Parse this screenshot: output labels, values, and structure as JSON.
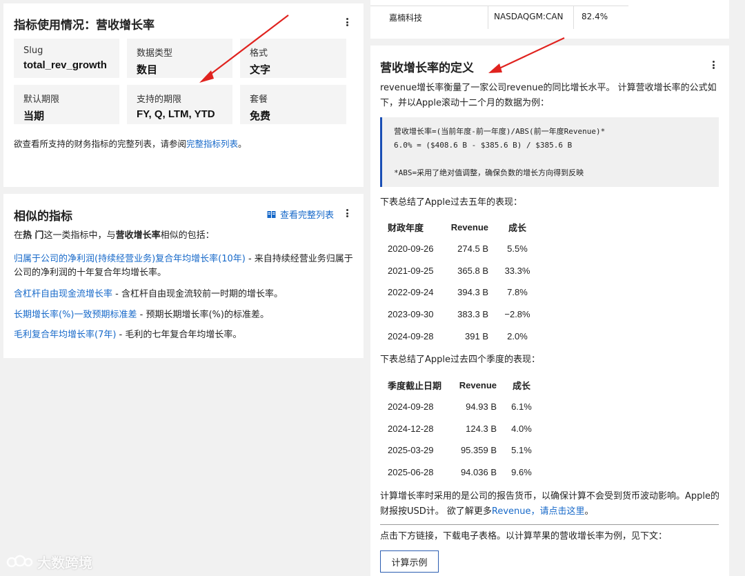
{
  "usage_card": {
    "title": "指标使用情况：营收增长率",
    "tiles": [
      {
        "label": "Slug",
        "value": "total_rev_growth"
      },
      {
        "label": "数据类型",
        "value": "数目"
      },
      {
        "label": "格式",
        "value": "文字"
      },
      {
        "label": "默认期限",
        "value": "当期"
      },
      {
        "label": "支持的期限",
        "value": "FY, Q, LTM, YTD"
      },
      {
        "label": "套餐",
        "value": "免费"
      }
    ],
    "note_prefix": "欲查看所支持的财务指标的完整列表，请参阅",
    "note_link": "完整指标列表",
    "note_suffix": "。"
  },
  "similar_card": {
    "title": "相似的指标",
    "view_all": "查看完整列表",
    "intro_1": "在",
    "intro_hot": "热 门",
    "intro_2": "这一类指标中，与",
    "intro_metric": "营收增长率",
    "intro_3": "相似的包括：",
    "items": [
      {
        "link": "归属于公司的净利润(持续经营业务)复合年均增长率(10年)",
        "desc": " - 来自持续经营业务归属于公司的净利润的十年复合年均增长率。"
      },
      {
        "link": "含杠杆自由现金流增长率",
        "desc": " - 含杠杆自由现金流较前一时期的增长率。"
      },
      {
        "link": "长期增长率(%)一致预期标准差",
        "desc": " - 预期长期增长率(%)的标准差。"
      },
      {
        "link": "毛利复合年均增长率(7年)",
        "desc": " - 毛利的七年复合年均增长率。"
      }
    ]
  },
  "top_row": {
    "name": "嘉楠科技",
    "ticker": "NASDAQGM:CAN",
    "value": "82.4%"
  },
  "definition_card": {
    "title": "营收增长率的定义",
    "intro": "revenue增长率衡量了一家公司revenue的同比增长水平。 计算营收增长率的公式如下，并以Apple滚动十二个月的数据为例：",
    "formula": "营收增长率=(当前年度-前一年度)/ABS(前一年度Revenue)*\n6.0% = ($408.6 B - $385.6 B) / $385.6 B\n\n*ABS=采用了绝对值调整，确保负数的增长方向得到反映",
    "annual_intro": "下表总结了Apple过去五年的表现：",
    "annual_headers": [
      "财政年度",
      "Revenue",
      "成长"
    ],
    "annual_rows": [
      [
        "2020-09-26",
        "274.5 B",
        "5.5%"
      ],
      [
        "2021-09-25",
        "365.8 B",
        "33.3%"
      ],
      [
        "2022-09-24",
        "394.3 B",
        "7.8%"
      ],
      [
        "2023-09-30",
        "383.3 B",
        "−2.8%"
      ],
      [
        "2024-09-28",
        "391 B",
        "2.0%"
      ]
    ],
    "quarter_intro": "下表总结了Apple过去四个季度的表现：",
    "quarter_headers": [
      "季度截止日期",
      "Revenue",
      "成长"
    ],
    "quarter_rows": [
      [
        "2024-09-28",
        "94.93 B",
        "6.1%"
      ],
      [
        "2024-12-28",
        "124.3 B",
        "4.0%"
      ],
      [
        "2025-03-29",
        "95.359 B",
        "5.1%"
      ],
      [
        "2025-06-28",
        "94.036 B",
        "9.6%"
      ]
    ],
    "currency_note": "计算增长率时采用的是公司的报告货币，以确保计算不会受到货币波动影响。Apple的财报按USD计。 欲了解更多",
    "currency_link": "Revenue，请点击这里",
    "currency_end": "。",
    "download_note": "点击下方链接，下载电子表格。以计算苹果的营收增长率为例，见下文：",
    "button": "计算示例"
  },
  "watermark": "大数跨境",
  "colors": {
    "accent": "#1769c9",
    "arrow": "#e0231f",
    "quote_bar": "#1a4fb5"
  }
}
